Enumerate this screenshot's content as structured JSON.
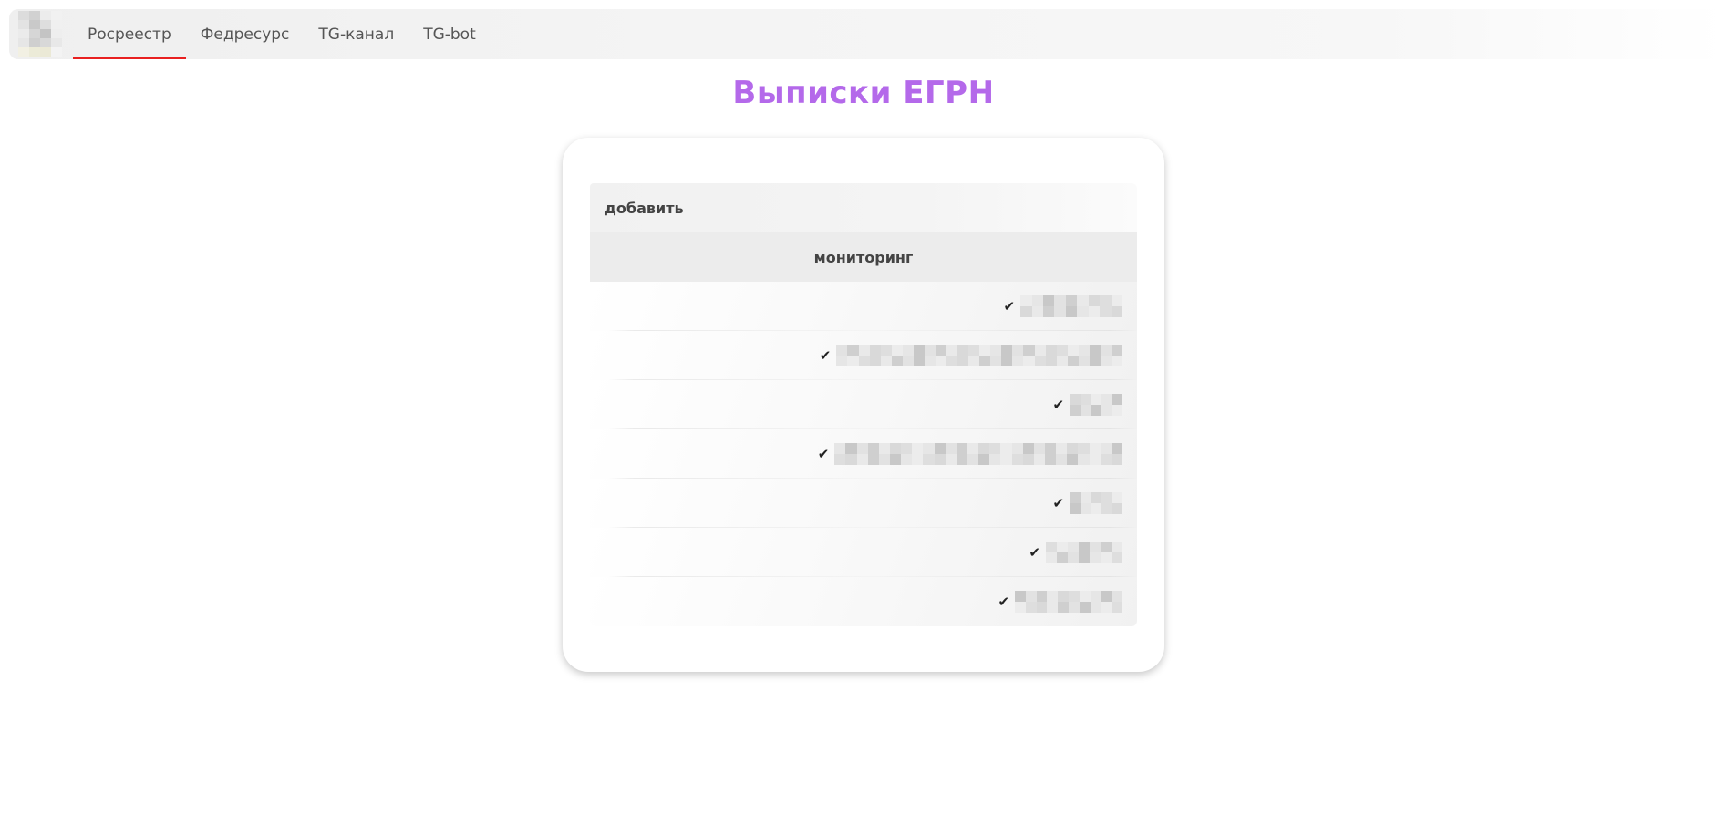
{
  "nav": {
    "logo_icon": "logo-icon",
    "items": [
      {
        "label": "Росреестр",
        "active": true
      },
      {
        "label": "Федресурс",
        "active": false
      },
      {
        "label": "TG-канал",
        "active": false
      },
      {
        "label": "TG-bot",
        "active": false
      }
    ]
  },
  "page": {
    "title": "Выписки ЕГРН"
  },
  "table": {
    "add_label": "добавить",
    "header_label": "мониторинг",
    "rows": [
      {
        "check": "✔",
        "blur_width": 112
      },
      {
        "check": "✔",
        "blur_width": 314
      },
      {
        "check": "✔",
        "blur_width": 58
      },
      {
        "check": "✔",
        "blur_width": 316
      },
      {
        "check": "✔",
        "blur_width": 58
      },
      {
        "check": "✔",
        "blur_width": 84
      },
      {
        "check": "✔",
        "blur_width": 118
      }
    ]
  },
  "colors": {
    "title": "#b469ea",
    "active_underline": "#e82020",
    "nav_text": "#555555"
  }
}
